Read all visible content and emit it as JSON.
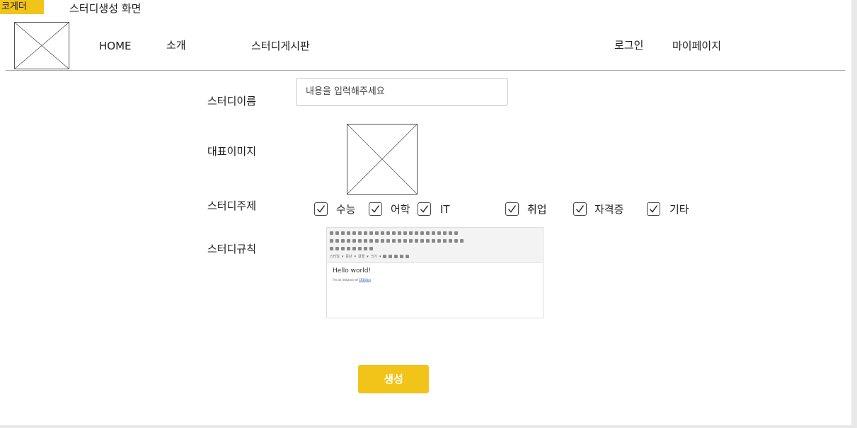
{
  "frame": {
    "tab_label": "코게더",
    "title": "스터디생성 화면"
  },
  "header": {
    "logo": "image-placeholder",
    "nav": [
      "HOME",
      "소개",
      "스터디게시판"
    ],
    "right": [
      "로그인",
      "마이페이지"
    ]
  },
  "form": {
    "name_label": "스터디이름",
    "name_placeholder": "내용을 입력해주세요",
    "image_label": "대표이미지",
    "topic_label": "스터디주제",
    "topics": [
      {
        "label": "수능",
        "checked": true
      },
      {
        "label": "어학",
        "checked": true
      },
      {
        "label": "IT",
        "checked": true
      },
      {
        "label": "취업",
        "checked": true
      },
      {
        "label": "자격증",
        "checked": true
      },
      {
        "label": "기타",
        "checked": true
      }
    ],
    "rules_label": "스터디규칙",
    "editor": {
      "heading": "Hello world!",
      "body_prefix": "I'm an instance of ",
      "body_link": "CKEditor",
      "body_suffix": ".",
      "toolbar_styles": [
        "스타일",
        "문단",
        "글꼴",
        "크기"
      ]
    },
    "submit_label": "생성"
  },
  "colors": {
    "accent": "#f2c318",
    "border": "#c9c9c9",
    "divider": "#aaaaaa"
  }
}
